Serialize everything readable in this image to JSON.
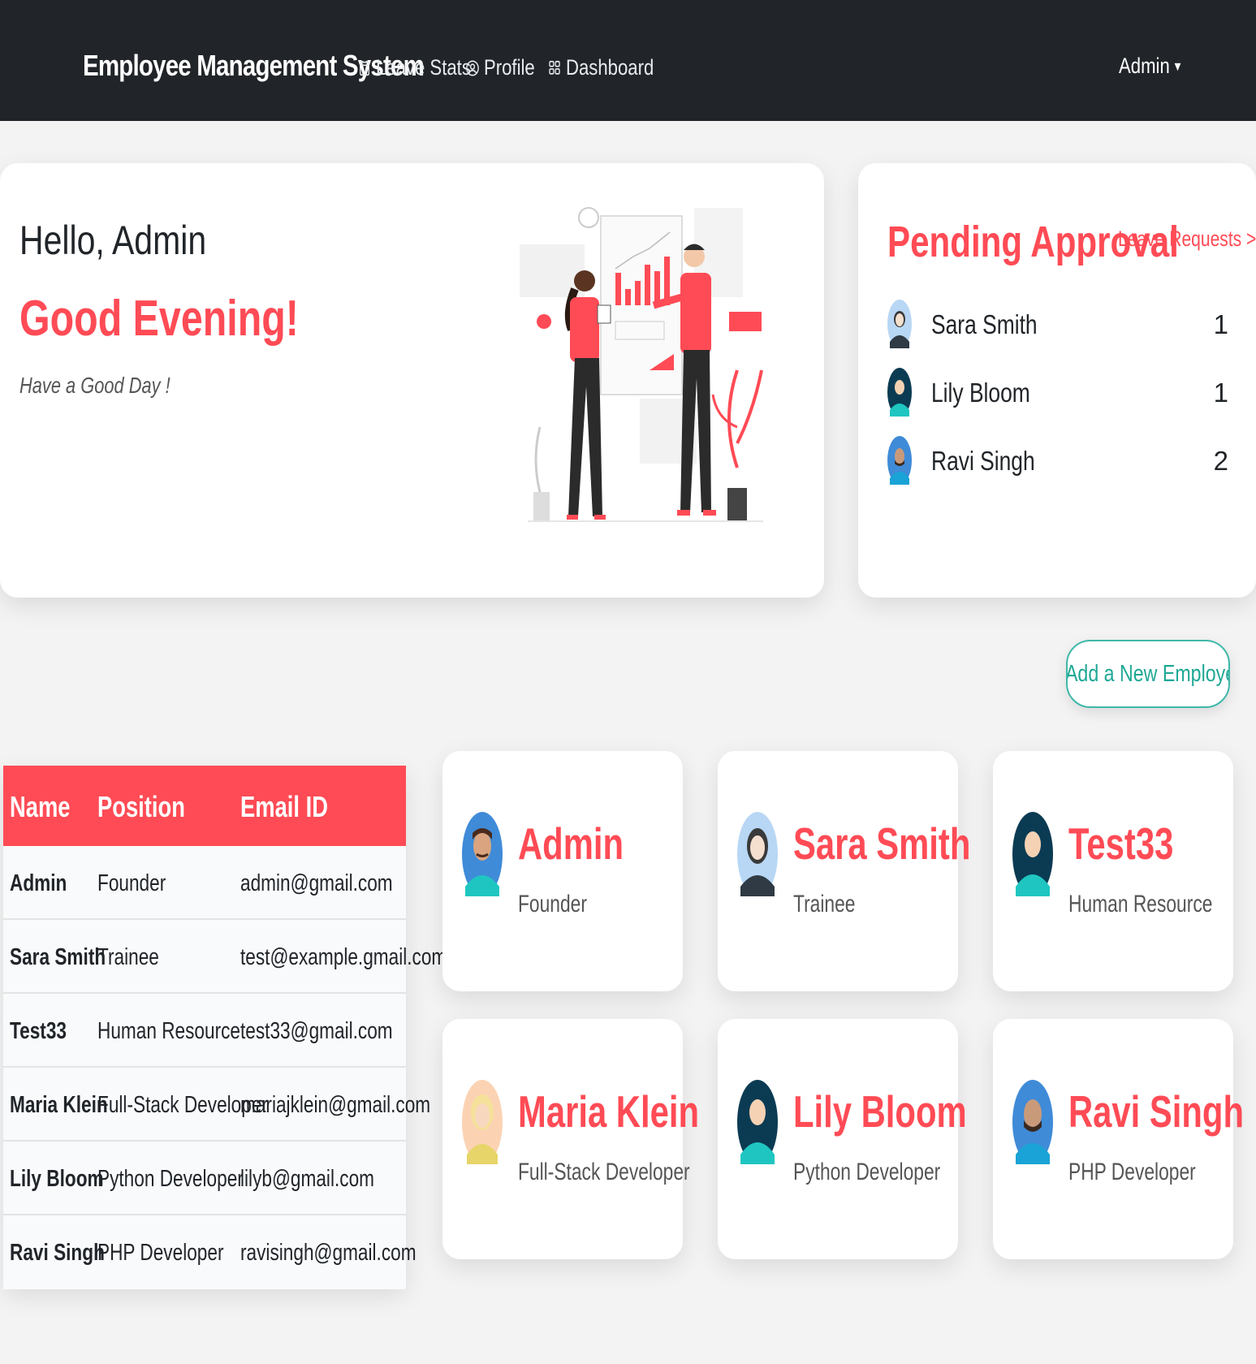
{
  "navbar": {
    "brand": "Employee Management System",
    "links": [
      {
        "label": "Leave Stats",
        "icon": "calendar-icon"
      },
      {
        "label": "Profile",
        "icon": "user-circle-icon"
      },
      {
        "label": "Dashboard",
        "icon": "grid-icon"
      }
    ],
    "user_menu": "Admin"
  },
  "greeting": {
    "hello": "Hello, Admin",
    "time_greeting": "Good Evening!",
    "subtitle": "Have a Good Day !"
  },
  "pending": {
    "title": "Pending Approval",
    "link": "Leave Requests >",
    "items": [
      {
        "name": "Sara Smith",
        "count": "1"
      },
      {
        "name": "Lily Bloom",
        "count": "1"
      },
      {
        "name": "Ravi Singh",
        "count": "2"
      }
    ]
  },
  "add_button": "+ Add a New Employee",
  "table": {
    "headers": [
      "Name",
      "Position",
      "Email ID"
    ],
    "rows": [
      [
        "Admin",
        "Founder",
        "admin@gmail.com"
      ],
      [
        "Sara Smith",
        "Trainee",
        "test@example.gmail.com"
      ],
      [
        "Test33",
        "Human Resource",
        "test33@gmail.com"
      ],
      [
        "Maria Klein",
        "Full-Stack Developer",
        "mariajklein@gmail.com"
      ],
      [
        "Lily Bloom",
        "Python Developer",
        "lilyb@gmail.com"
      ],
      [
        "Ravi Singh",
        "PHP Developer",
        "ravisingh@gmail.com"
      ]
    ]
  },
  "employees": [
    {
      "name": "Admin",
      "position": "Founder"
    },
    {
      "name": "Sara Smith",
      "position": "Trainee"
    },
    {
      "name": "Test33",
      "position": "Human Resource"
    },
    {
      "name": "Maria Klein",
      "position": "Full-Stack Developer"
    },
    {
      "name": "Lily Bloom",
      "position": "Python Developer"
    },
    {
      "name": "Ravi Singh",
      "position": "PHP Developer"
    }
  ],
  "colors": {
    "accent": "#ff4b55",
    "navbar": "#212529",
    "teal": "#1ea895"
  }
}
